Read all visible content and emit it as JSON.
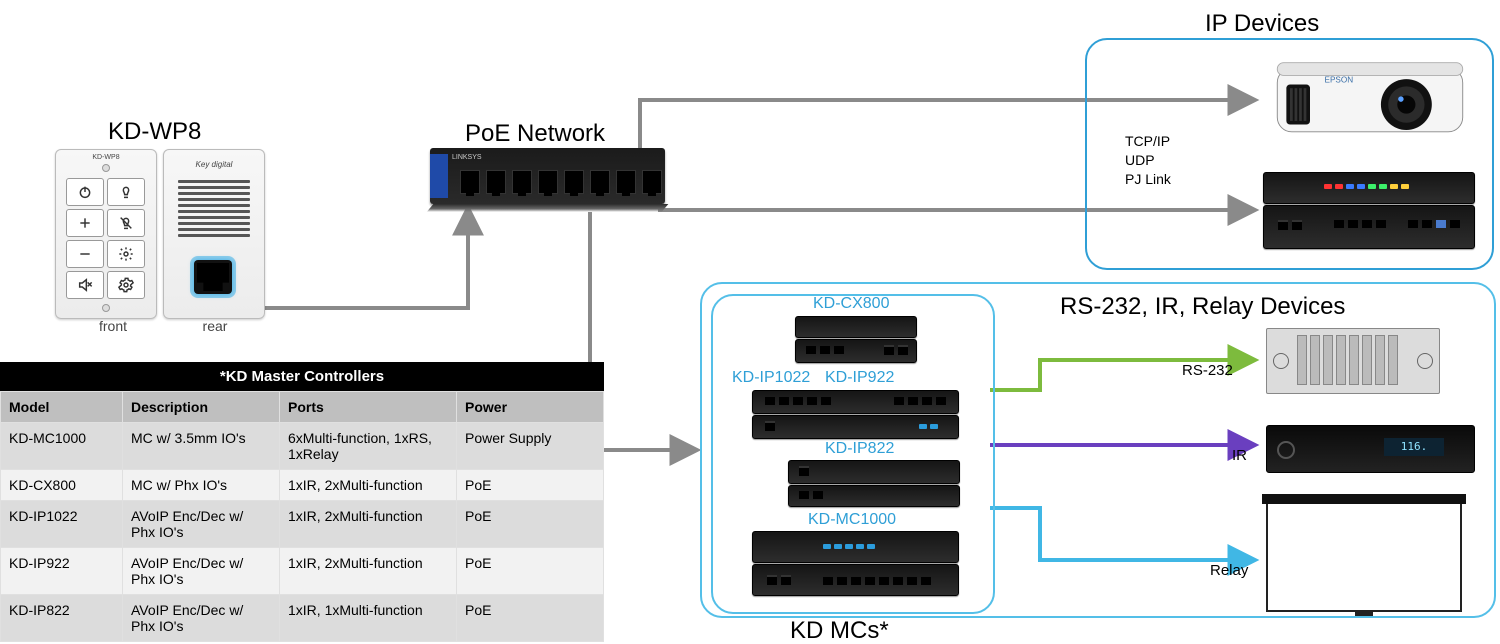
{
  "titles": {
    "wp8": "KD-WP8",
    "poe": "PoE Network",
    "ip": "IP Devices",
    "rs": "RS-232, IR, Relay Devices",
    "kdmcs": "KD MCs*"
  },
  "wp8": {
    "brand": "KD-WP8",
    "rear_brand": "Key digital",
    "front": "front",
    "rear": "rear"
  },
  "switch": {
    "brand": "LINKSYS"
  },
  "protocols": {
    "l1": "TCP/IP",
    "l2": "UDP",
    "l3": "PJ Link"
  },
  "kd_mcs": {
    "cx800": "KD-CX800",
    "ip1022": "KD-IP1022",
    "ip922": "KD-IP922",
    "ip822": "KD-IP822",
    "mc1000": "KD-MC1000"
  },
  "conn": {
    "rs232": "RS-232",
    "ir": "IR",
    "relay": "Relay"
  },
  "dvr": {
    "display": "116."
  },
  "table": {
    "caption": "*KD Master Controllers",
    "headers": [
      "Model",
      "Description",
      "Ports",
      "Power"
    ],
    "rows": [
      {
        "model": "KD-MC1000",
        "desc": "MC w/ 3.5mm IO's",
        "ports": "6xMulti-function, 1xRS, 1xRelay",
        "power": "Power Supply"
      },
      {
        "model": "KD-CX800",
        "desc": "MC w/ Phx IO's",
        "ports": "1xIR, 2xMulti-function",
        "power": "PoE"
      },
      {
        "model": "KD-IP1022",
        "desc": "AVoIP Enc/Dec w/ Phx IO's",
        "ports": "1xIR, 2xMulti-function",
        "power": "PoE"
      },
      {
        "model": "KD-IP922",
        "desc": "AVoIP Enc/Dec w/ Phx IO's",
        "ports": "1xIR, 2xMulti-function",
        "power": "PoE"
      },
      {
        "model": "KD-IP822",
        "desc": "AVoIP Enc/Dec w/ Phx IO's",
        "ports": "1xIR, 1xMulti-function",
        "power": "PoE"
      }
    ]
  }
}
